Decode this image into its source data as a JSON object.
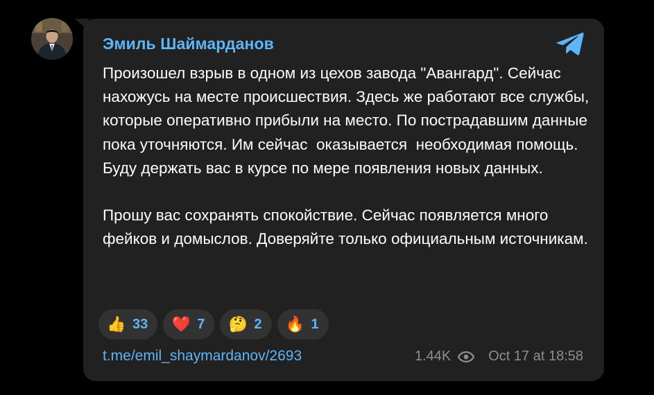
{
  "post": {
    "author": "Эмиль Шаймарданов",
    "paragraphs": [
      "Произошел взрыв в одном из цехов завода \"Авангард\". Сейчас нахожусь на месте происшествия. Здесь же работают все службы, которые оперативно прибыли на место. По пострадавшим данные пока уточняются. Им сейчас  оказывается  необходимая помощь. Буду держать вас в курсе по мере появления новых данных.",
      "Прошу вас сохранять спокойствие. Сейчас появляется много фейков и домыслов. Доверяйте только официальным источникам."
    ],
    "reactions": [
      {
        "emoji": "👍",
        "icon": "thumbs-up-icon",
        "count": "33"
      },
      {
        "emoji": "❤️",
        "icon": "heart-icon",
        "count": "7"
      },
      {
        "emoji": "🤔",
        "icon": "thinking-face-icon",
        "count": "2"
      },
      {
        "emoji": "🔥",
        "icon": "fire-icon",
        "count": "1"
      }
    ],
    "link": "t.me/emil_shaymardanov/2693",
    "views": "1.44K",
    "timestamp": "Oct 17 at 18:58"
  },
  "colors": {
    "background": "#000000",
    "bubble": "#212121",
    "accent": "#5eb5f7",
    "text": "#ffffff",
    "muted": "#8e8e93",
    "reaction_bg": "#323232"
  },
  "icons": {
    "avatar": "avatar",
    "channel": "telegram-icon",
    "views": "eye-icon"
  }
}
